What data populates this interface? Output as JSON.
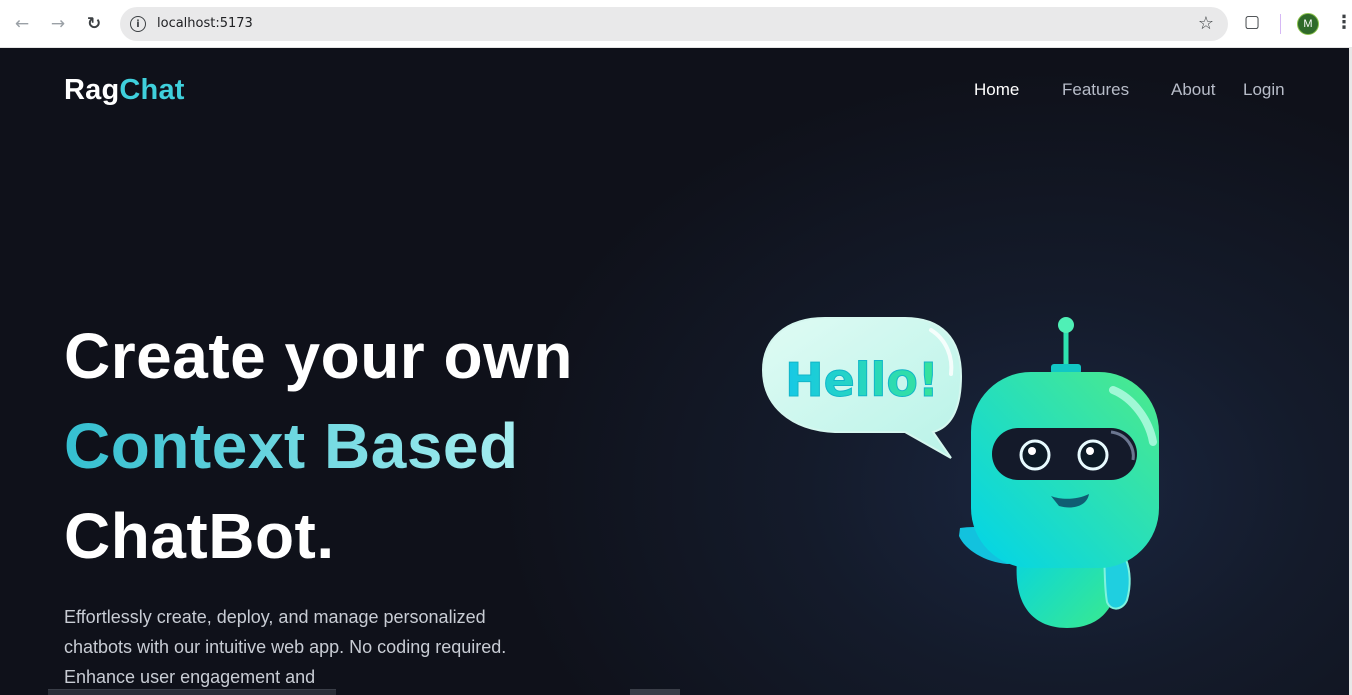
{
  "browser": {
    "url": "localhost:5173",
    "profile_initial": "M",
    "icons": {
      "back": "arrow-left-icon",
      "forward": "arrow-right-icon",
      "reload": "reload-icon",
      "info": "info-icon",
      "bookmark": "star-icon",
      "extensions": "puzzle-icon",
      "menu": "kebab-menu-icon"
    }
  },
  "site": {
    "logo_part1": "Rag",
    "logo_part2": "Chat",
    "nav": [
      {
        "label": "Home",
        "active": true
      },
      {
        "label": "Features",
        "active": false
      },
      {
        "label": "About",
        "active": false
      },
      {
        "label": "Login",
        "active": false
      }
    ]
  },
  "hero": {
    "line1": "Create your own",
    "line2": "Context Based",
    "line3": "ChatBot.",
    "description": "Effortlessly create, deploy, and manage personalized chatbots with our intuitive web app. No coding required. Enhance user engagement and",
    "bubble_text": "Hello!"
  },
  "colors": {
    "background": "#0f111a",
    "accent": "#3fd0dc",
    "robot_green": "#2ee59d",
    "robot_cyan": "#00d4e8"
  }
}
